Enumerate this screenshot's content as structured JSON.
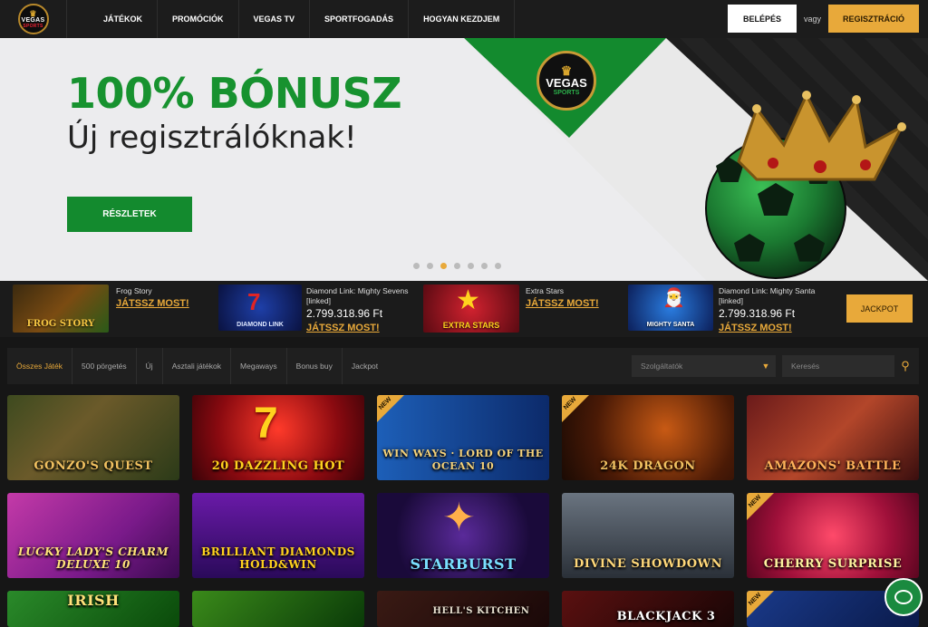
{
  "header": {
    "logo_text": "VEGAS",
    "logo_sub": "SPORTS",
    "nav": [
      {
        "label": "JÁTÉKOK"
      },
      {
        "label": "PROMÓCIÓK"
      },
      {
        "label": "VEGAS TV"
      },
      {
        "label": "SPORTFOGADÁS"
      },
      {
        "label": "HOGYAN KEZDJEM"
      }
    ],
    "login_label": "BELÉPÉS",
    "or_label": "vagy",
    "register_label": "REGISZTRÁCIÓ"
  },
  "hero": {
    "title": "100% BÓNUSZ",
    "subtitle": "Új regisztrálóknak!",
    "button_label": "RÉSZLETEK",
    "logo_text": "VEGAS",
    "logo_sub": "SPORTS",
    "slide_count": 7,
    "active_slide": 3
  },
  "jackpots": [
    {
      "name": "Frog Story",
      "name2": "",
      "amount": "",
      "play": "JÁTSSZ MOST!",
      "thumb_label": "FROG STORY"
    },
    {
      "name": "Diamond Link: Mighty Sevens",
      "name2": "[linked]",
      "amount": "2.799.318.96 Ft",
      "play": "JÁTSSZ MOST!",
      "thumb_label": "DIAMOND LINK"
    },
    {
      "name": "Extra Stars",
      "name2": "",
      "amount": "",
      "play": "JÁTSSZ MOST!",
      "thumb_label": "EXTRA STARS"
    },
    {
      "name": "Diamond Link: Mighty Santa",
      "name2": "[linked]",
      "amount": "2.799.318.96 Ft",
      "play": "JÁTSSZ MOST!",
      "thumb_label": "MIGHTY SANTA"
    }
  ],
  "jackpot_button": "JACKPOT",
  "filters": {
    "tabs": [
      {
        "label": "Összes Játék"
      },
      {
        "label": "500 pörgetés"
      },
      {
        "label": "Új"
      },
      {
        "label": "Asztali játékok"
      },
      {
        "label": "Megaways"
      },
      {
        "label": "Bonus buy"
      },
      {
        "label": "Jackpot"
      }
    ],
    "provider_placeholder": "Szolgáltatók",
    "search_placeholder": "Keresés"
  },
  "new_badge": "NEW",
  "games": [
    {
      "label": "GONZO'S QUEST",
      "new": false
    },
    {
      "label": "20 DAZZLING HOT",
      "new": false
    },
    {
      "label": "WIN WAYS · LORD OF THE OCEAN 10",
      "new": true
    },
    {
      "label": "24K DRAGON",
      "new": true
    },
    {
      "label": "AMAZONS' BATTLE",
      "new": false
    },
    {
      "label": "LUCKY LADY'S CHARM DELUXE 10",
      "new": false
    },
    {
      "label": "BRILLIANT DIAMONDS HOLD&WIN",
      "new": false
    },
    {
      "label": "STARBURST",
      "new": false
    },
    {
      "label": "DIVINE SHOWDOWN",
      "new": false
    },
    {
      "label": "CHERRY SURPRISE",
      "new": true
    },
    {
      "label": "IRISH",
      "new": false
    },
    {
      "label": "",
      "new": false
    },
    {
      "label": "HELL'S KITCHEN",
      "new": false
    },
    {
      "label": "BLACKJACK 3",
      "new": false
    },
    {
      "label": "",
      "new": true
    }
  ],
  "colors": {
    "accent": "#e8a93a",
    "green": "#138a2e"
  }
}
